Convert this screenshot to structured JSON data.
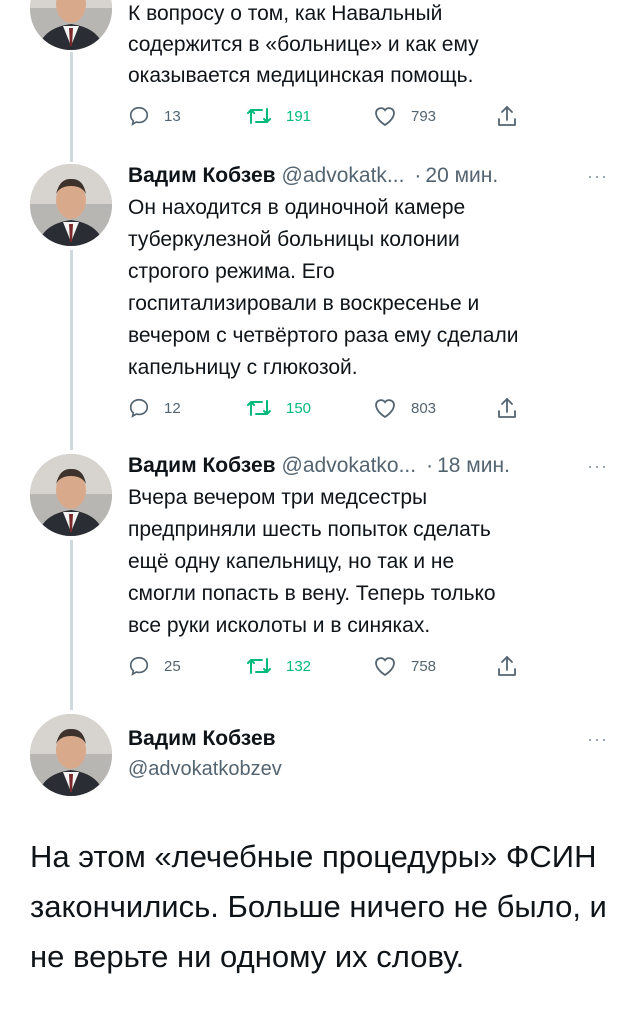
{
  "thread": [
    {
      "body": "К вопросу о том, как Навальный\nсодержится в «больнице» и как ему\nоказывается медицинская помощь.",
      "replies": "13",
      "retweets": "191",
      "likes": "793"
    },
    {
      "name": "Вадим Кобзев",
      "handle": "@advokatk...",
      "time": "20 мин.",
      "body": "Он находится в одиночной камере\nтуберкулезной больницы колонии\nстрогого режима. Его\nгоспитализировали в воскресенье и\nвечером с четвёртого раза ему сделали\nкапельницу с глюкозой.",
      "replies": "12",
      "retweets": "150",
      "likes": "803"
    },
    {
      "name": "Вадим Кобзев",
      "handle": "@advokatko...",
      "time": "18 мин.",
      "body": "Вчера вечером три медсестры\nпредприняли шесть попыток сделать\nещё одну капельницу, но так и не\nсмогли попасть в вену. Теперь только\nвсе руки исколоты и в синяках.",
      "replies": "25",
      "retweets": "132",
      "likes": "758"
    }
  ],
  "main_tweet": {
    "name": "Вадим Кобзев",
    "handle": "@advokatkobzev",
    "text": "На этом «лечебные процедуры» ФСИН закончились. Больше ничего не было, и не верьте ни одному их слову."
  },
  "ui": {
    "dot": "·",
    "more": "···"
  },
  "icons": {
    "reply": "reply-icon",
    "retweet": "retweet-icon",
    "like": "heart-icon",
    "share": "share-icon",
    "more": "more-icon"
  },
  "colors": {
    "text": "#0f1419",
    "secondary": "#536471",
    "retweet_green": "#00ba7c",
    "thread_line": "#cfd9de"
  }
}
